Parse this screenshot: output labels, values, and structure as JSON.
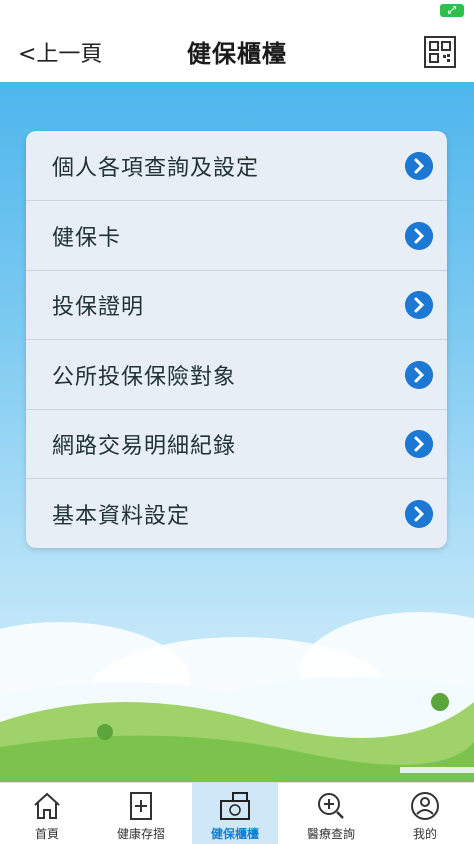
{
  "status": {
    "badge": "⤢"
  },
  "header": {
    "back_label": "<上一頁",
    "title": "健保櫃檯"
  },
  "menu": [
    {
      "label": "個人各項查詢及設定"
    },
    {
      "label": "健保卡"
    },
    {
      "label": "投保證明"
    },
    {
      "label": "公所投保保險對象"
    },
    {
      "label": "網路交易明細紀錄"
    },
    {
      "label": "基本資料設定"
    }
  ],
  "tabs": [
    {
      "label": "首頁",
      "icon": "home-icon"
    },
    {
      "label": "健康存摺",
      "icon": "health-book-icon"
    },
    {
      "label": "健保櫃檯",
      "icon": "counter-icon",
      "active": true
    },
    {
      "label": "醫療查詢",
      "icon": "medical-search-icon"
    },
    {
      "label": "我的",
      "icon": "user-settings-icon"
    }
  ],
  "colors": {
    "accent": "#1d78d3",
    "sky": "#4fb6ec",
    "active_tab": "#1a7fd0"
  }
}
